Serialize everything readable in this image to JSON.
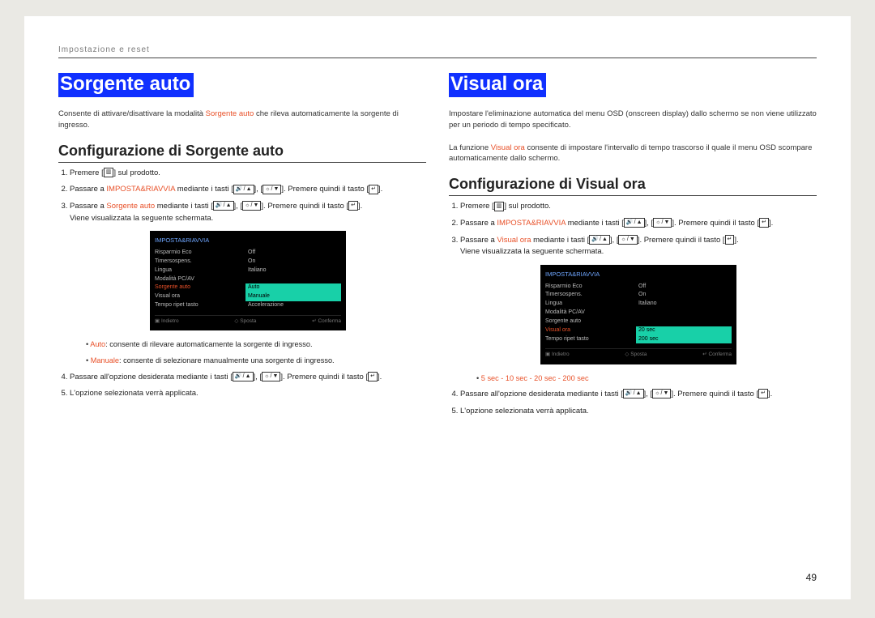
{
  "header": "Impostazione e reset",
  "pageNumber": "49",
  "left": {
    "title": "Sorgente auto",
    "intro1a": "Consente di attivare/disattivare la modalità ",
    "intro1b": " che rileva automaticamente la sorgente di ingresso.",
    "introHL": "Sorgente auto",
    "subtitle": "Configurazione di Sorgente auto",
    "step1a": "Premere ",
    "step1b": " sul prodotto.",
    "step2a": "Passare a ",
    "step2HL": "IMPOSTA&RIAVVIA",
    "step2b": " mediante i tasti ",
    "step2c": ". Premere quindi il tasto ",
    "step3a": "Passare a ",
    "step3HL": "Sorgente auto",
    "step3b": " mediante i tasti ",
    "step3c": ". Premere quindi il tasto ",
    "step3d": "Viene visualizzata la seguente schermata.",
    "bullet1HL": "Auto",
    "bullet1": ": consente di rilevare automaticamente la sorgente di ingresso.",
    "bullet2HL": "Manuale",
    "bullet2": ": consente di selezionare manualmente una sorgente di ingresso.",
    "step4a": "Passare all'opzione desiderata mediante i tasti ",
    "step4b": ". Premere quindi il tasto ",
    "step5": "L'opzione selezionata verrà applicata.",
    "osd": {
      "title": "IMPOSTA&RIAVVIA",
      "rows": [
        {
          "lbl": "Risparmio Eco",
          "val": "Off"
        },
        {
          "lbl": "Timersospens.",
          "val": "On"
        },
        {
          "lbl": "Lingua",
          "val": "Italiano"
        },
        {
          "lbl": "Modalità PC/AV",
          "val": ""
        },
        {
          "lbl": "Sorgente auto",
          "val": "Auto",
          "sel": true
        },
        {
          "lbl": "Visual ora",
          "val": "Manuale",
          "hot": true
        },
        {
          "lbl": "Tempo ripet tasto",
          "val": "Accelerazione"
        }
      ],
      "footL": "Indietro",
      "footM": "Sposta",
      "footR": "Conferma"
    }
  },
  "right": {
    "title": "Visual ora",
    "intro1": "Impostare l'eliminazione automatica del menu OSD (onscreen display) dallo schermo se non viene utilizzato per un periodo di tempo specificato.",
    "intro2a": "La funzione ",
    "intro2HL": "Visual ora",
    "intro2b": " consente di impostare l'intervallo di tempo trascorso il quale il menu OSD scompare automaticamente dallo schermo.",
    "subtitle": "Configurazione di Visual ora",
    "step1a": "Premere ",
    "step1b": " sul prodotto.",
    "step2a": "Passare a ",
    "step2HL": "IMPOSTA&RIAVVIA",
    "step2b": " mediante i tasti ",
    "step2c": ". Premere quindi il tasto ",
    "step3a": "Passare a ",
    "step3HL": "Visual ora",
    "step3b": " mediante i tasti ",
    "step3c": ". Premere quindi il tasto ",
    "step3d": "Viene visualizzata la seguente schermata.",
    "bullet": "5 sec - 10 sec - 20 sec - 200 sec",
    "step4a": "Passare all'opzione desiderata mediante i tasti ",
    "step4b": ". Premere quindi il tasto ",
    "step5": "L'opzione selezionata verrà applicata.",
    "osd": {
      "title": "IMPOSTA&RIAVVIA",
      "rows": [
        {
          "lbl": "Risparmio Eco",
          "val": "Off"
        },
        {
          "lbl": "Timersospens.",
          "val": "On"
        },
        {
          "lbl": "Lingua",
          "val": "Italiano"
        },
        {
          "lbl": "Modalità PC/AV",
          "val": ""
        },
        {
          "lbl": "Sorgente auto",
          "val": ""
        },
        {
          "lbl": "Visual ora",
          "val": "20 sec",
          "sel": true
        },
        {
          "lbl": "Tempo ripet tasto",
          "val": "200 sec",
          "hot": true
        }
      ],
      "footL": "Indietro",
      "footM": "Sposta",
      "footR": "Conferma"
    }
  }
}
